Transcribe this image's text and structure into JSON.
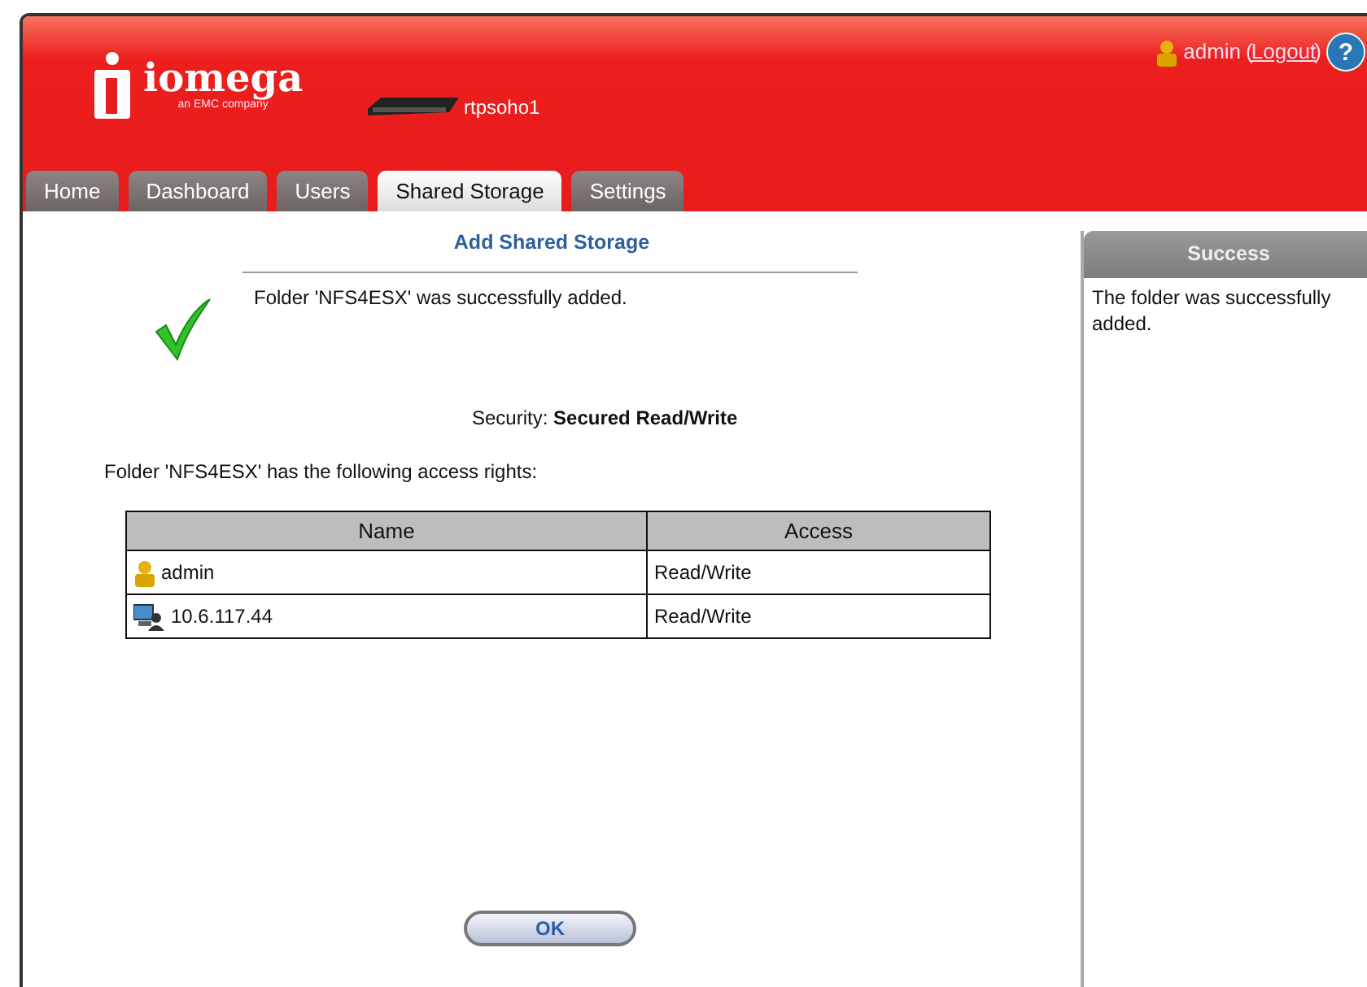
{
  "header": {
    "logo": {
      "brand": "iomega",
      "tagline": "an EMC company"
    },
    "device": "rtpsoho1",
    "user": "admin",
    "logout_open": "(",
    "logout": "Logout",
    "logout_close": ")",
    "help": "?"
  },
  "tabs": [
    {
      "label": "Home",
      "selected": false
    },
    {
      "label": "Dashboard",
      "selected": false
    },
    {
      "label": "Users",
      "selected": false
    },
    {
      "label": "Shared Storage",
      "selected": true
    },
    {
      "label": "Settings",
      "selected": false
    }
  ],
  "main": {
    "title": "Add Shared Storage",
    "message": "Folder 'NFS4ESX' was successfully added.",
    "security_label": "Security:",
    "security_value": "Secured Read/Write",
    "rights_text": "Folder 'NFS4ESX' has the following access rights:",
    "table": {
      "columns": [
        "Name",
        "Access"
      ],
      "rows": [
        {
          "kind": "user",
          "name": "admin",
          "access": "Read/Write"
        },
        {
          "kind": "host",
          "name": "10.6.117.44",
          "access": "Read/Write"
        }
      ]
    },
    "ok_button": "OK"
  },
  "side_panel": {
    "title": "Success",
    "text": "The folder was successfully added."
  }
}
